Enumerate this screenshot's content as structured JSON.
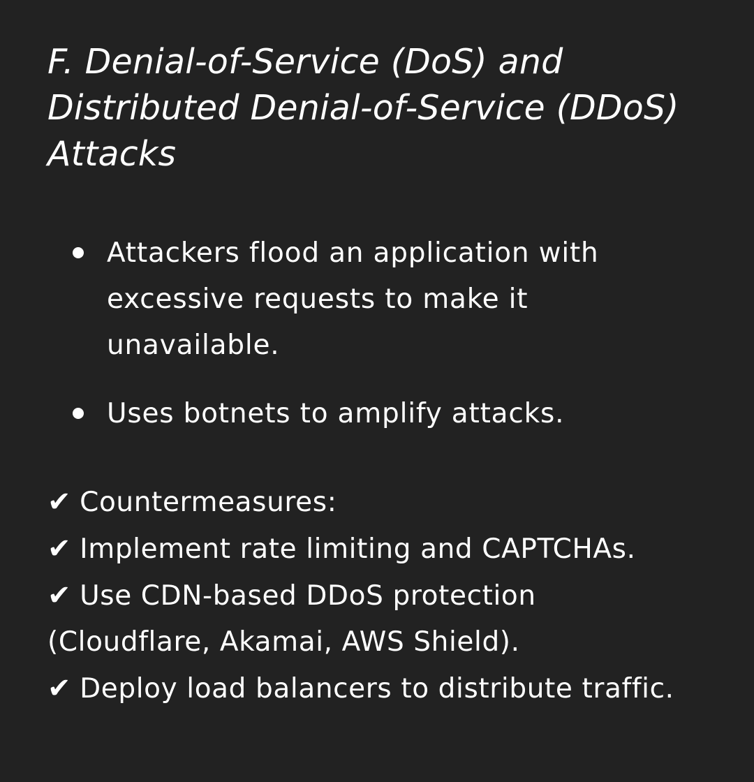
{
  "heading": "F. Denial-of-Service (DoS) and Distributed Denial-of-Service (DDoS) Attacks",
  "bullets": [
    "Attackers flood an application with excessive requests to make it unavailable.",
    "Uses botnets to amplify attacks."
  ],
  "countermeasures": {
    "check_symbol": "✔",
    "lines": [
      "Countermeasures:",
      "Implement rate limiting and CAPTCHAs.",
      "Use CDN-based DDoS protection (Cloudflare, Akamai, AWS Shield).",
      "Deploy load balancers to distribute traffic."
    ]
  }
}
